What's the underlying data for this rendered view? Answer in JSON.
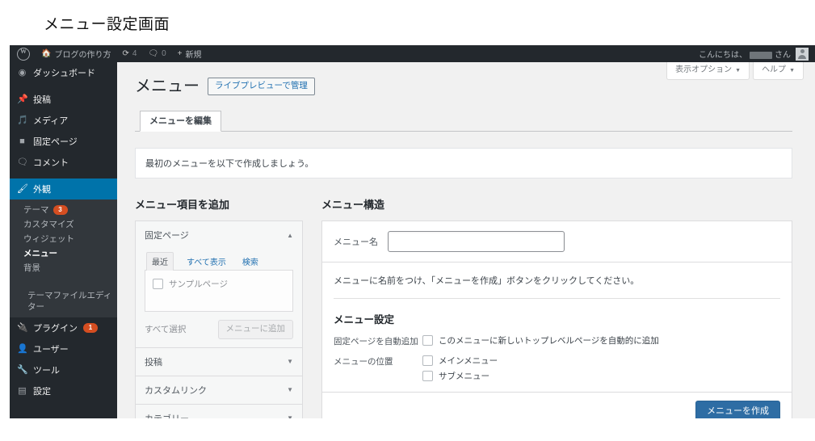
{
  "caption": "メニュー設定画面",
  "adminbar": {
    "logo_icon": "wordpress-logo-icon",
    "site_icon": "home-icon",
    "site_name": "ブログの作り方",
    "updates_icon": "updates-icon",
    "updates_count": "4",
    "comments_icon": "comment-icon",
    "comments_count": "0",
    "new_icon": "plus-icon",
    "new_label": "新規",
    "greeting": "こんにちは、",
    "greeting_suffix": "さん",
    "avatar_name": "avatar"
  },
  "screen_meta": {
    "screen_options": "表示オプション",
    "help": "ヘルプ",
    "caret": "▼"
  },
  "sidebar": {
    "items": [
      {
        "label": "ダッシュボード",
        "icon": "dashboard-icon",
        "glyph": "◉",
        "name": "dashboard"
      },
      {
        "label": "投稿",
        "icon": "pin-icon",
        "glyph": "✒",
        "name": "posts"
      },
      {
        "label": "メディア",
        "icon": "media-icon",
        "glyph": "♫",
        "name": "media"
      },
      {
        "label": "固定ページ",
        "icon": "page-icon",
        "glyph": "▤",
        "name": "pages"
      },
      {
        "label": "コメント",
        "icon": "comment-icon",
        "glyph": "🗨",
        "name": "comments"
      },
      {
        "label": "外観",
        "icon": "appearance-brush-icon",
        "glyph": "✎",
        "name": "appearance",
        "current": true
      },
      {
        "label": "プラグイン",
        "icon": "plugin-icon",
        "glyph": "⚡",
        "name": "plugins",
        "badge": "1"
      },
      {
        "label": "ユーザー",
        "icon": "user-icon",
        "glyph": "👤",
        "name": "users"
      },
      {
        "label": "ツール",
        "icon": "tools-wrench-icon",
        "glyph": "🔧",
        "name": "tools"
      },
      {
        "label": "設定",
        "icon": "settings-icon",
        "glyph": "🎛",
        "name": "settings"
      }
    ],
    "appearance_submenu": [
      {
        "label": "テーマ",
        "badge": "3",
        "name": "themes"
      },
      {
        "label": "カスタマイズ",
        "name": "customize"
      },
      {
        "label": "ウィジェット",
        "name": "widgets"
      },
      {
        "label": "メニュー",
        "name": "menus",
        "current": true
      },
      {
        "label": "背景",
        "name": "background"
      },
      {
        "label": "テーマファイルエディター",
        "name": "theme-file-editor"
      }
    ]
  },
  "page": {
    "title": "メニュー",
    "title_action": "ライブプレビューで管理",
    "tab": "メニューを編集",
    "notice": "最初のメニューを以下で作成しましょう。"
  },
  "add_items": {
    "heading": "メニュー項目を追加",
    "sections": [
      {
        "label": "固定ページ",
        "name": "pages",
        "open": true,
        "caret": "▲"
      },
      {
        "label": "投稿",
        "name": "posts",
        "open": false,
        "caret": "▼"
      },
      {
        "label": "カスタムリンク",
        "name": "custom-links",
        "open": false,
        "caret": "▼"
      },
      {
        "label": "カテゴリー",
        "name": "categories",
        "open": false,
        "caret": "▼"
      }
    ],
    "pages_tabs": [
      {
        "label": "最近",
        "active": true
      },
      {
        "label": "すべて表示",
        "active": false
      },
      {
        "label": "検索",
        "active": false
      }
    ],
    "page_item": "サンプルページ",
    "select_all": "すべて選択",
    "add_button": "メニューに追加"
  },
  "structure": {
    "heading": "メニュー構造",
    "name_label": "メニュー名",
    "name_value": "",
    "name_placeholder": "",
    "hint": "メニューに名前をつけ、「メニューを作成」ボタンをクリックしてください。",
    "settings_title": "メニュー設定",
    "auto_add_label": "固定ページを自動追加",
    "auto_add_option": "このメニューに新しいトップレベルページを自動的に追加",
    "location_label": "メニューの位置",
    "location_options": [
      {
        "label": "メインメニュー",
        "checked": false
      },
      {
        "label": "サブメニュー",
        "checked": false
      }
    ],
    "create_button": "メニューを作成"
  },
  "colors": {
    "admin_bar": "#23282d",
    "sidebar": "#23282d",
    "submenu": "#32373c",
    "current_menu": "#0073aa",
    "badge": "#d54e21",
    "primary_button": "#2e6da4",
    "link": "#2271b1",
    "page_bg": "#f1f1f1"
  }
}
